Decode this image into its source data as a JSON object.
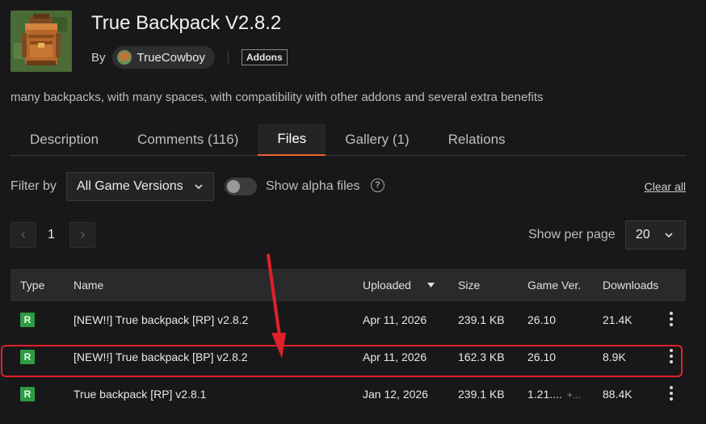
{
  "project": {
    "title": "True Backpack V2.8.2",
    "by_label": "By",
    "author": "TrueCowboy",
    "category": "Addons",
    "summary": "many backpacks, with many spaces, with compatibility with other addons and several extra benefits"
  },
  "tabs": [
    {
      "label": "Description"
    },
    {
      "label": "Comments (116)"
    },
    {
      "label": "Files",
      "active": true
    },
    {
      "label": "Gallery (1)"
    },
    {
      "label": "Relations"
    }
  ],
  "filters": {
    "filter_label": "Filter by",
    "version_select": "All Game Versions",
    "alpha_label": "Show alpha files",
    "alpha_enabled": false,
    "clear_all": "Clear all"
  },
  "pagination": {
    "current_page": "1",
    "per_page_label": "Show per page",
    "per_page_value": "20"
  },
  "table": {
    "headers": {
      "type": "Type",
      "name": "Name",
      "uploaded": "Uploaded",
      "size": "Size",
      "game_ver": "Game Ver.",
      "downloads": "Downloads"
    },
    "rows": [
      {
        "type": "R",
        "name": "[NEW!!] True backpack [RP] v2.8.2",
        "uploaded": "Apr 11, 2026",
        "size": "239.1 KB",
        "game_ver": "26.10",
        "extra": "",
        "downloads": "21.4K"
      },
      {
        "type": "R",
        "name": "[NEW!!] True backpack [BP] v2.8.2",
        "uploaded": "Apr 11, 2026",
        "size": "162.3 KB",
        "game_ver": "26.10",
        "extra": "",
        "downloads": "8.9K",
        "highlighted": true
      },
      {
        "type": "R",
        "name": "True backpack [RP] v2.8.1",
        "uploaded": "Jan 12, 2026",
        "size": "239.1 KB",
        "game_ver": "1.21....",
        "extra": "+...",
        "downloads": "88.4K"
      }
    ]
  },
  "colors": {
    "accent": "#f16436",
    "release_badge": "#2e9b44",
    "highlight": "#e0202a",
    "background": "#18181a"
  },
  "icons": [
    "backpack-thumbnail",
    "author-avatar",
    "chevron-down-icon",
    "help-icon",
    "chevron-left-icon",
    "chevron-right-icon",
    "sort-desc-icon",
    "kebab-menu-icon",
    "red-arrow-annotation"
  ]
}
